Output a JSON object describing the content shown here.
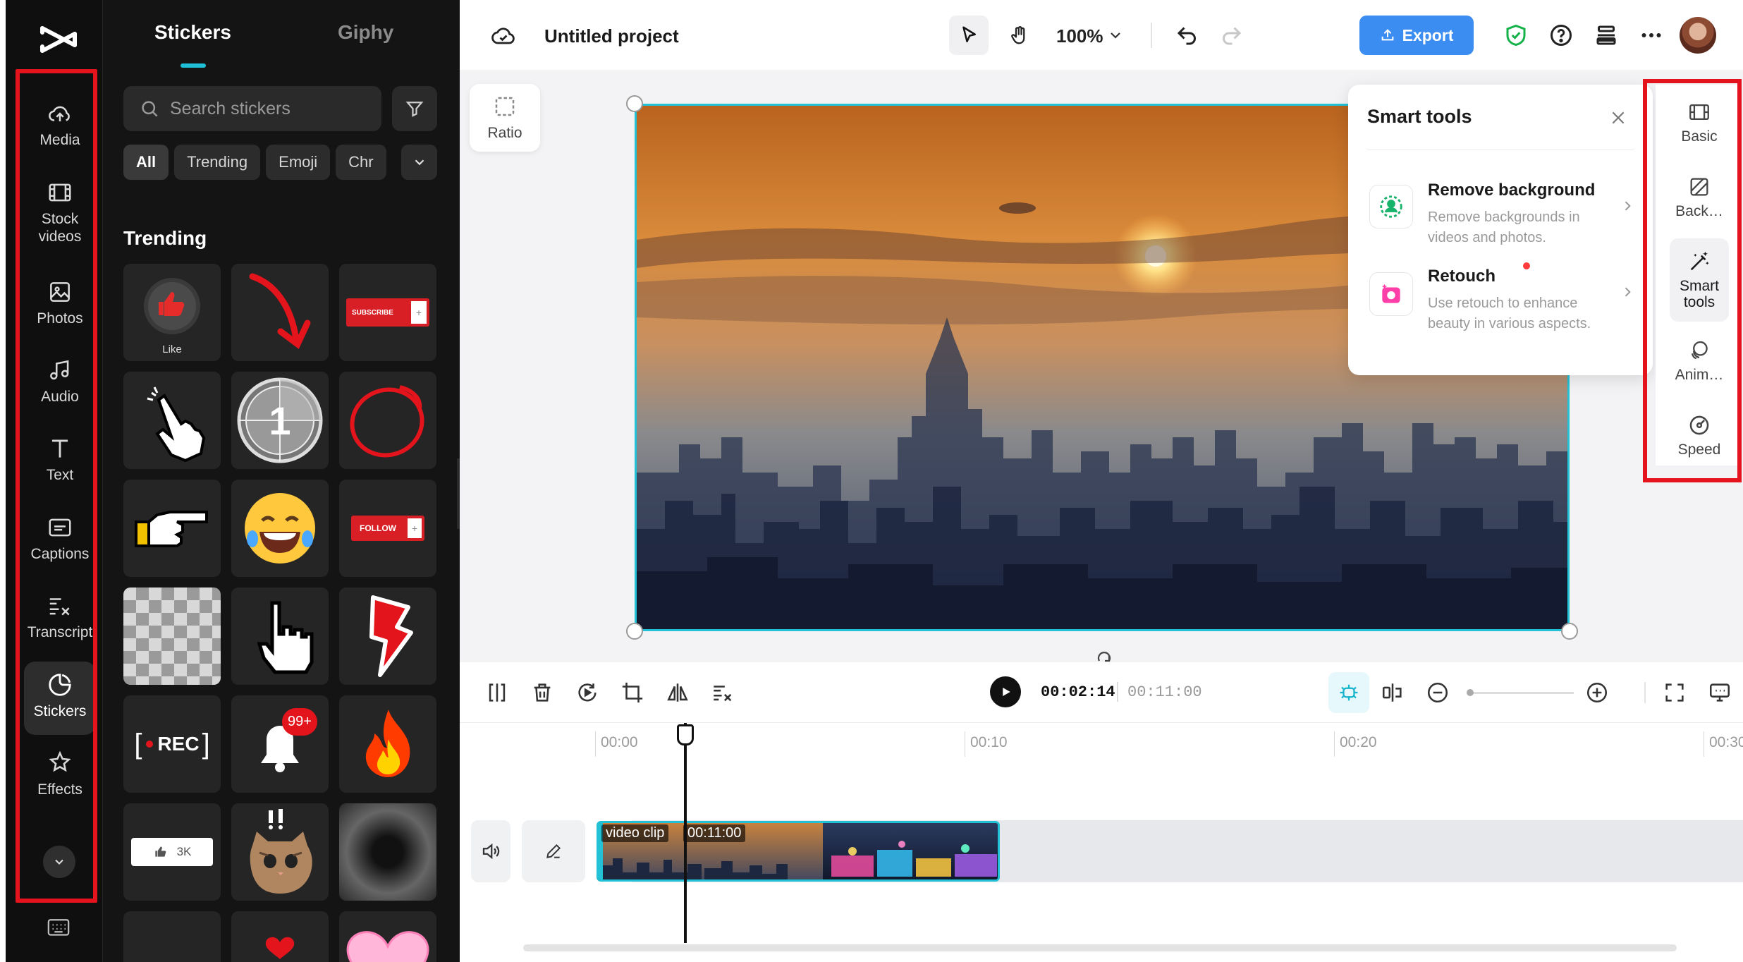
{
  "app": {
    "project_title": "Untitled project",
    "zoom_level": "100%",
    "export_label": "Export",
    "logo_icon": "capcut-logo-icon"
  },
  "nav": {
    "items": [
      {
        "label": "Media",
        "icon": "cloud-upload-icon"
      },
      {
        "label": "Stock\nvideos",
        "icon": "film-icon"
      },
      {
        "label": "Photos",
        "icon": "image-icon"
      },
      {
        "label": "Audio",
        "icon": "music-note-icon"
      },
      {
        "label": "Text",
        "icon": "text-t-icon"
      },
      {
        "label": "Captions",
        "icon": "captions-icon"
      },
      {
        "label": "Transcript",
        "icon": "transcript-icon"
      },
      {
        "label": "Stickers",
        "icon": "sticker-icon"
      },
      {
        "label": "Effects",
        "icon": "sparkle-star-icon"
      }
    ],
    "active": "Stickers"
  },
  "panel": {
    "tabs": [
      "Stickers",
      "Giphy"
    ],
    "active_tab": "Stickers",
    "search_placeholder": "Search stickers",
    "chips": [
      "All",
      "Trending",
      "Emoji",
      "Chr"
    ],
    "active_chip": "All",
    "section_title": "Trending",
    "stickers": [
      {
        "name": "like-button-sticker",
        "caption": "Like"
      },
      {
        "name": "red-arrow-sticker"
      },
      {
        "name": "subscribe-button-sticker",
        "text": "SUBSCRIBE"
      },
      {
        "name": "pointing-hand-cursor-sticker"
      },
      {
        "name": "countdown-one-sticker",
        "text": "1"
      },
      {
        "name": "red-circle-scribble-sticker"
      },
      {
        "name": "pointing-finger-sticker"
      },
      {
        "name": "laughing-emoji-sticker"
      },
      {
        "name": "follow-button-sticker",
        "text": "FOLLOW"
      },
      {
        "name": "pixel-mosaic-sticker"
      },
      {
        "name": "pixel-hand-cursor-sticker"
      },
      {
        "name": "lightning-bolt-sticker"
      },
      {
        "name": "rec-indicator-sticker",
        "text": "REC"
      },
      {
        "name": "notification-bell-sticker",
        "text": "99+"
      },
      {
        "name": "fire-sticker"
      },
      {
        "name": "thumbs-up-count-sticker",
        "text": "3K"
      },
      {
        "name": "surprised-cat-sticker"
      },
      {
        "name": "dark-burst-sticker"
      }
    ]
  },
  "canvas": {
    "ratio_label": "Ratio"
  },
  "smart_tools": {
    "title": "Smart tools",
    "items": [
      {
        "name": "Remove background",
        "description": "Remove backgrounds in videos and photos.",
        "icon": "remove-background-icon"
      },
      {
        "name": "Retouch",
        "description": "Use retouch to enhance beauty in various aspects.",
        "icon": "retouch-icon",
        "new_dot": true
      }
    ]
  },
  "properties": {
    "items": [
      {
        "label": "Basic",
        "icon": "film-frame-icon"
      },
      {
        "label": "Back…",
        "icon": "background-slash-icon"
      },
      {
        "label": "Smart\ntools",
        "icon": "magic-wand-icon"
      },
      {
        "label": "Anim…",
        "icon": "animation-circles-icon"
      },
      {
        "label": "Speed",
        "icon": "speedometer-icon"
      }
    ],
    "active": "Smart\ntools"
  },
  "player": {
    "current_time": "00:02:14",
    "total_time": "00:11:00"
  },
  "timeline": {
    "ruler": [
      "00:00",
      "00:10",
      "00:20",
      "00:30"
    ],
    "clip": {
      "label": "video clip",
      "duration": "00:11:00"
    }
  },
  "colors": {
    "accent": "#22c1d6",
    "export_button": "#3b8df1",
    "highlight_box": "#e5131d",
    "nav_bg": "#0f0f0f",
    "panel_bg": "#141414"
  }
}
